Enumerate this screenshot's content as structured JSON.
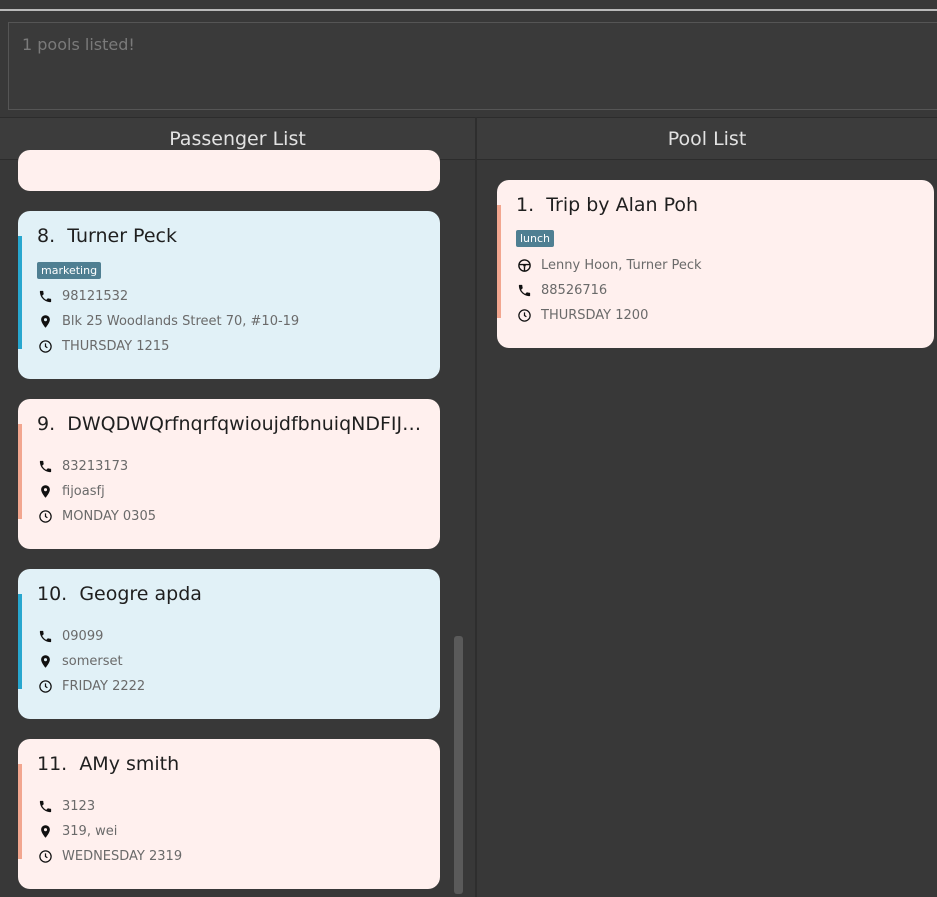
{
  "result": {
    "message": "1 pools listed!"
  },
  "passenger_panel": {
    "title": "Passenger List"
  },
  "pool_panel": {
    "title": "Pool List"
  },
  "passengers": [
    {
      "index": "8.",
      "name": "Turner Peck",
      "tag": "marketing",
      "phone": "98121532",
      "address": "Blk 25 Woodlands Street 70, #10-19",
      "time": "THURSDAY 1215"
    },
    {
      "index": "9.",
      "name": "DWQDWQrfnqrfqwioujdfbnuiqNDFIJKQ...",
      "phone": "83213173",
      "address": "fijoasfj",
      "time": "MONDAY 0305"
    },
    {
      "index": "10.",
      "name": "Geogre apda",
      "phone": "09099",
      "address": "somerset",
      "time": "FRIDAY 2222"
    },
    {
      "index": "11.",
      "name": "AMy smith",
      "phone": "3123",
      "address": "319, wei",
      "time": "WEDNESDAY 2319"
    }
  ],
  "pools": [
    {
      "index": "1.",
      "title": "Trip by Alan Poh",
      "tag": "lunch",
      "passengers": "Lenny Hoon, Turner Peck",
      "phone": "88526716",
      "time": "THURSDAY 1200"
    }
  ],
  "icons": {
    "phone": "phone-icon",
    "location": "location-pin-icon",
    "clock": "clock-icon",
    "steering": "steering-wheel-icon"
  }
}
